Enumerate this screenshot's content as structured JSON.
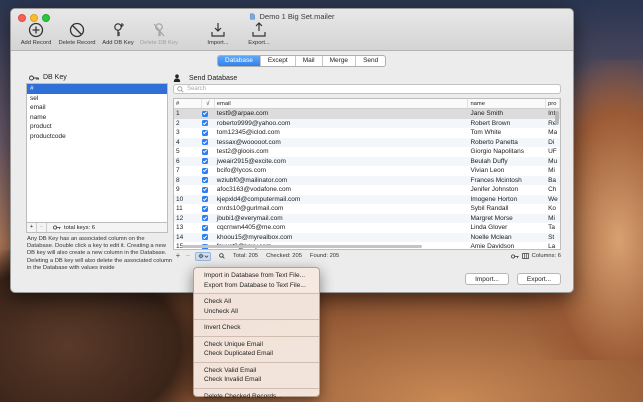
{
  "window": {
    "title": "Demo 1 Big Set.mailer"
  },
  "toolbar": {
    "add_record": "Add Record",
    "delete_record": "Delete Record",
    "add_db_key": "Add DB Key",
    "delete_db_key": "Delete DB Key",
    "import": "Import...",
    "export": "Export..."
  },
  "tabs": [
    "Database",
    "Except",
    "Mail",
    "Merge",
    "Send"
  ],
  "active_tab": "Database",
  "left_panel": {
    "title": "DB Key",
    "keys": [
      "#",
      "sel",
      "email",
      "name",
      "product",
      "productcode"
    ],
    "selected_key": "#",
    "total_keys": "total keys: 6",
    "help_text": "Any DB Key has an associated column on the Database. Double click a key to edit it. Creating a new DB key will also create a new column in the Database. Deleting a DB key will also delete the associated column in the Database with values inside"
  },
  "right_panel": {
    "title": "Send Database",
    "search_placeholder": "Search",
    "columns": {
      "num": "#",
      "chk": "√",
      "email": "email",
      "name": "name",
      "pro": "pro"
    },
    "rows": [
      {
        "num": "1",
        "email": "test9@arpae.com",
        "name": "Jane Smith",
        "pro": "Int"
      },
      {
        "num": "2",
        "email": "roberto9999@yahoo.com",
        "name": "Robert Brown",
        "pro": "Re"
      },
      {
        "num": "3",
        "email": "tom12345@iclod.com",
        "name": "Tom White",
        "pro": "Ma"
      },
      {
        "num": "4",
        "email": "tessax@wooooot.com",
        "name": "Roberto Panetta",
        "pro": "Di"
      },
      {
        "num": "5",
        "email": "test2@gloois.com",
        "name": "Giorgio Napolitans",
        "pro": "UF"
      },
      {
        "num": "6",
        "email": "jweair2915@excite.com",
        "name": "Beulah Duffy",
        "pro": "Mu"
      },
      {
        "num": "7",
        "email": "bcifo@lycos.com",
        "name": "Vivian Leon",
        "pro": "Mi"
      },
      {
        "num": "8",
        "email": "wziubf0@mailinator.com",
        "name": "Frances Mcintosh",
        "pro": "Ba"
      },
      {
        "num": "9",
        "email": "afoc3163@vodafone.com",
        "name": "Jenifer Johnston",
        "pro": "Ch"
      },
      {
        "num": "10",
        "email": "kjepxld4@computermail.com",
        "name": "Imogene Horton",
        "pro": "We"
      },
      {
        "num": "11",
        "email": "cnrds10@gurlmail.com",
        "name": "Sybil Randall",
        "pro": "Ko"
      },
      {
        "num": "12",
        "email": "jbubi1@everymail.com",
        "name": "Margret Morse",
        "pro": "Mi"
      },
      {
        "num": "13",
        "email": "cqcrnwn4405@me.com",
        "name": "Linda Glover",
        "pro": "Ta"
      },
      {
        "num": "14",
        "email": "khoou15@myrealbox.com",
        "name": "Noelle Mclean",
        "pro": "St"
      },
      {
        "num": "15",
        "email": "fnuxst0@kaxy.com",
        "name": "Amie Davidson",
        "pro": "La"
      }
    ],
    "status": {
      "total": "Total: 205",
      "checked": "Checked: 205",
      "found": "Found: 205",
      "columns": "Columns: 6"
    }
  },
  "buttons": {
    "import": "Import...",
    "export": "Export..."
  },
  "context_menu": {
    "groups": [
      [
        "Import in Database from Text File...",
        "Export from Database to Text File..."
      ],
      [
        "Check All",
        "Uncheck All"
      ],
      [
        "Invert Check"
      ],
      [
        "Check Unique Email",
        "Check Duplicated Email"
      ],
      [
        "Check Valid  Email",
        "Check Invalid  Email"
      ],
      [
        "Delete Checked Records..."
      ]
    ]
  },
  "colors": {
    "accent": "#2f82ee",
    "checkbox": "#2f7ff2",
    "selection": "#2f6fd6"
  }
}
